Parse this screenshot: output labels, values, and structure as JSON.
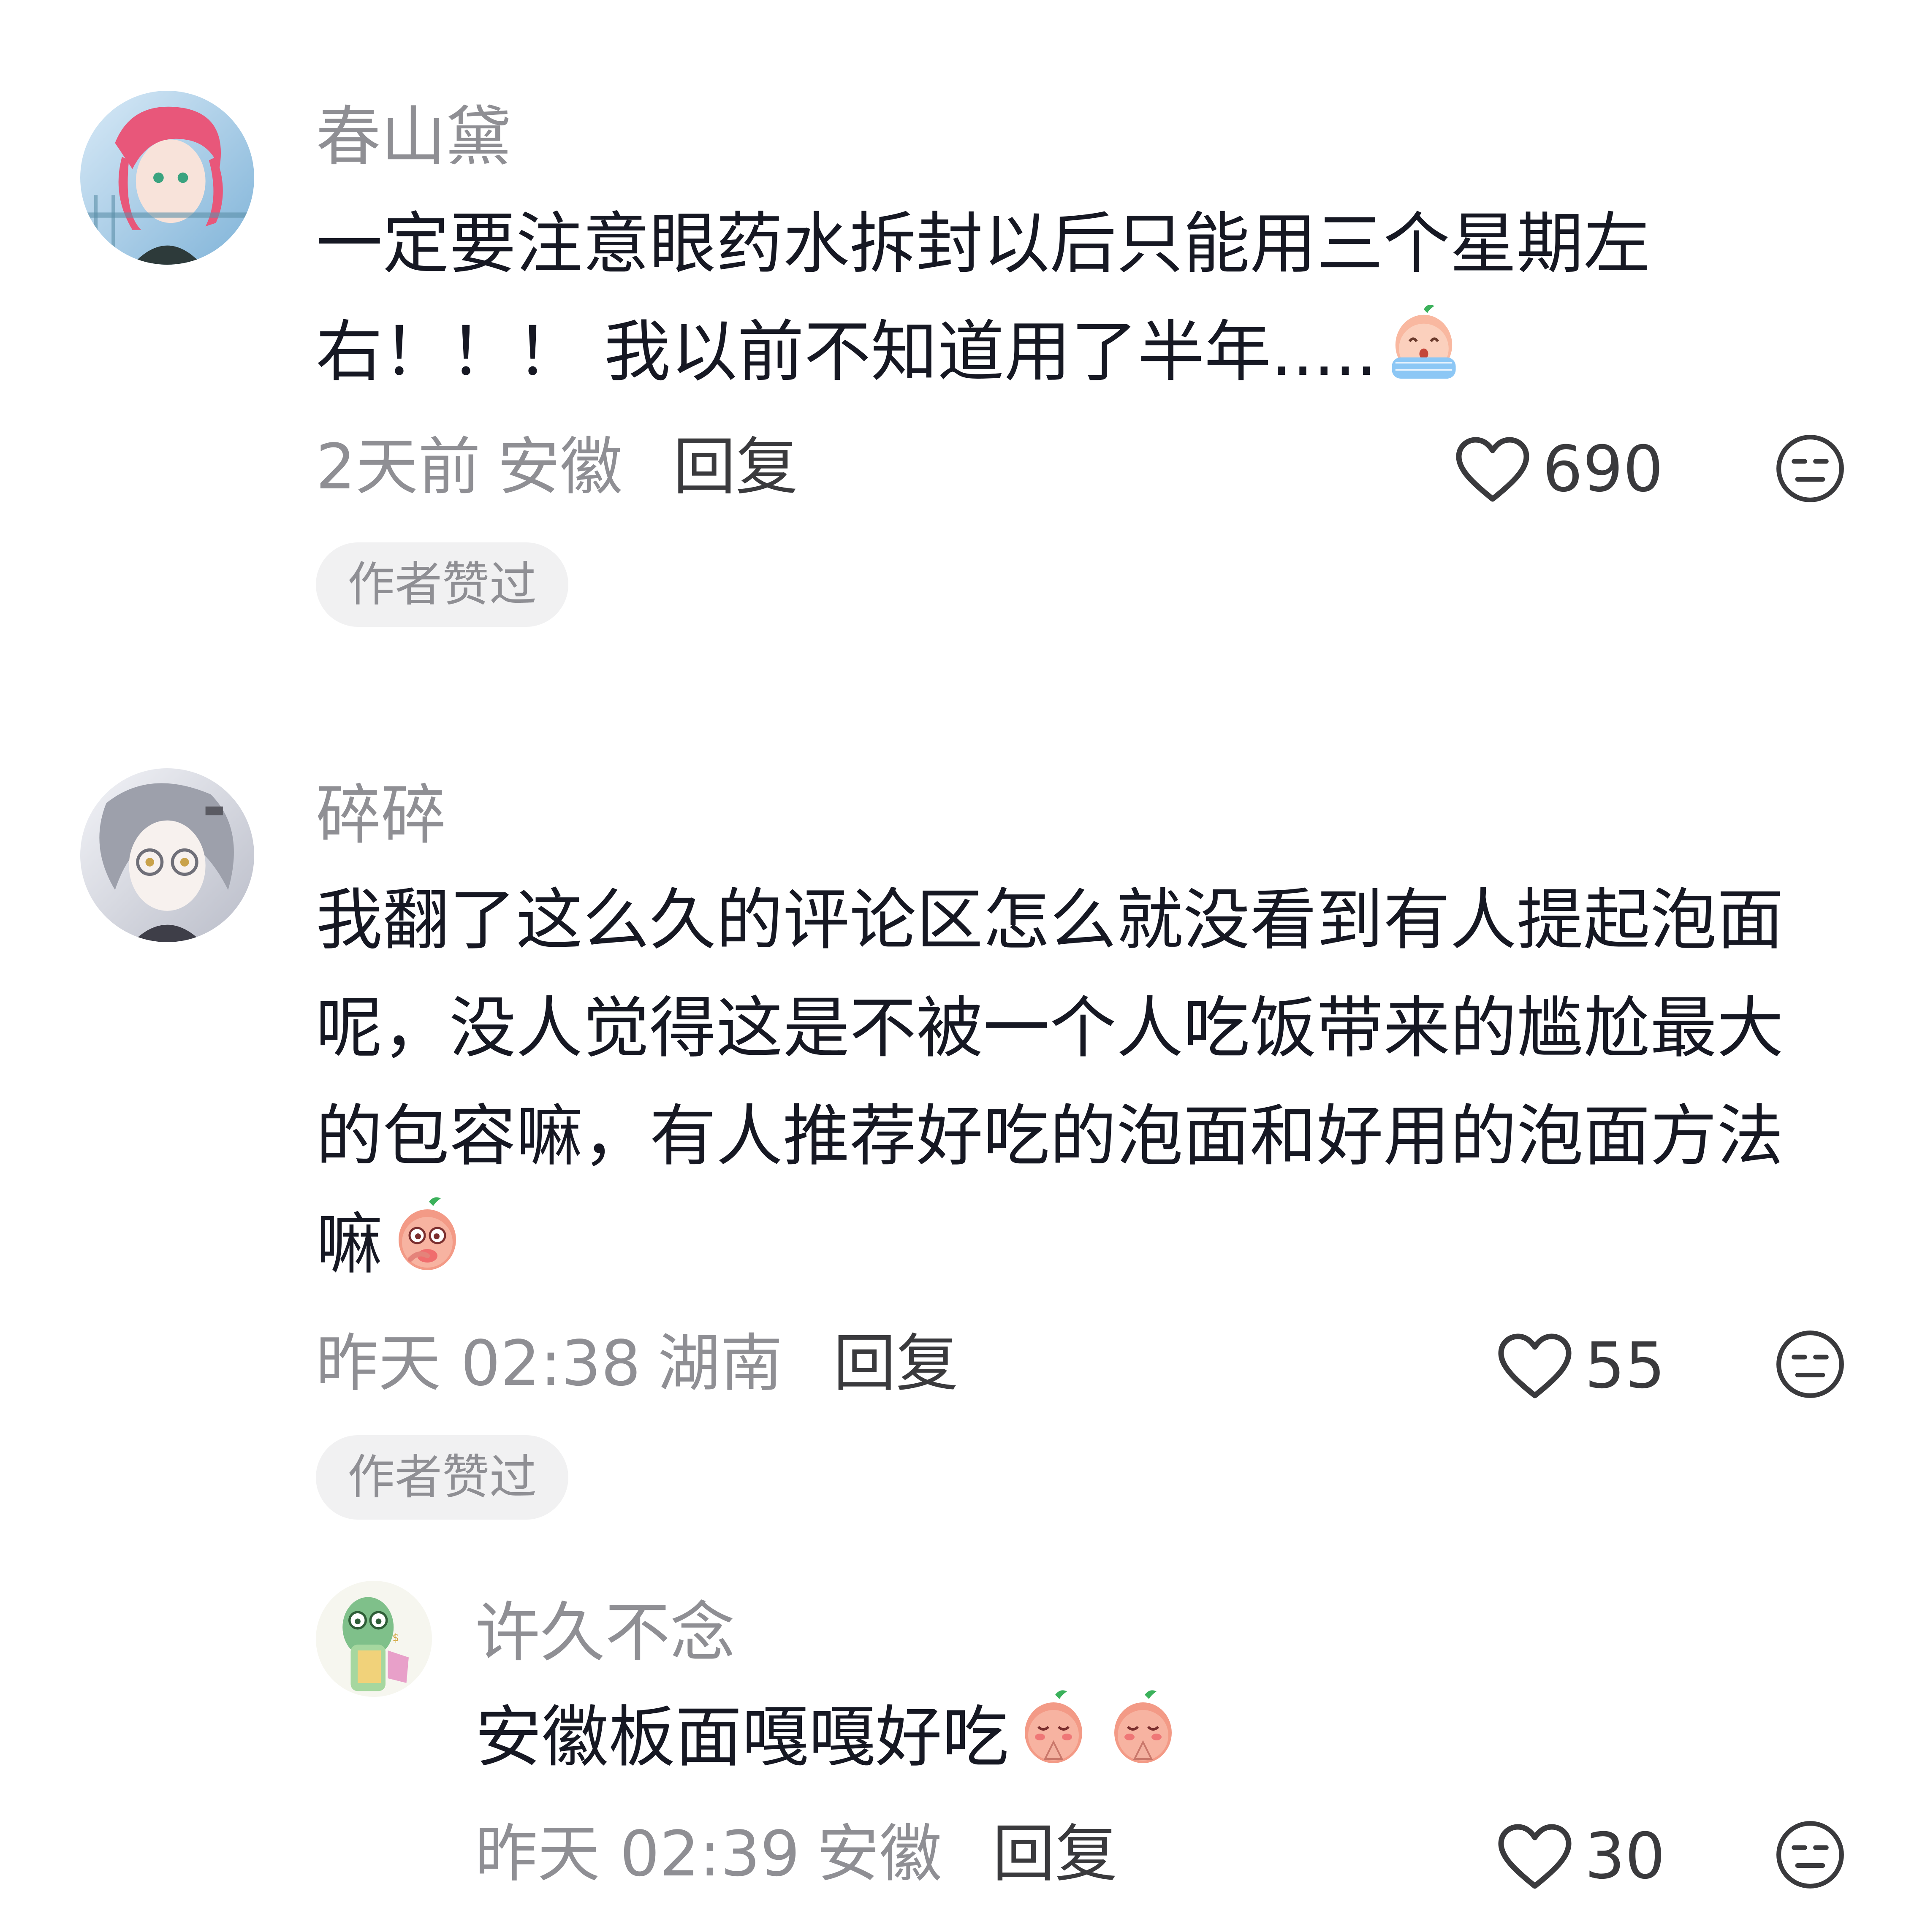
{
  "comments": [
    {
      "username": "春山黛",
      "lines": [
        "一定要注意眼药水拆封以后只能用三个星期左",
        "右！！！ 我以前不知道用了半年....."
      ],
      "time": "2天前",
      "location": "安徽",
      "reply_label": "回复",
      "like_count": "690",
      "badge": "作者赞过"
    },
    {
      "username": "碎碎",
      "lines": [
        "我翻了这么久的评论区怎么就没看到有人提起泡面",
        "呢，没人觉得这是不被一个人吃饭带来的尴尬最大",
        "的包容嘛，有人推荐好吃的泡面和好用的泡面方法",
        "嘛"
      ],
      "time": "昨天 02:38",
      "location": "湖南",
      "reply_label": "回复",
      "like_count": "55",
      "badge": "作者赞过"
    }
  ],
  "reply": {
    "username": "许久不念",
    "text": "安徽板面嘎嘎好吃",
    "time": "昨天 02:39",
    "location": "安徽",
    "reply_label": "回复",
    "like_count": "30"
  },
  "colors": {
    "text_primary": "#161823",
    "text_secondary": "#8f8f94",
    "badge_bg": "#f1f1f2"
  },
  "icons": {
    "like": "heart-outline-icon",
    "dislike": "meh-face-icon",
    "emoji_cry": "crying-peach-emoji",
    "emoji_shy": "shy-peach-emoji",
    "emoji_praise": "pray-peach-emoji"
  }
}
